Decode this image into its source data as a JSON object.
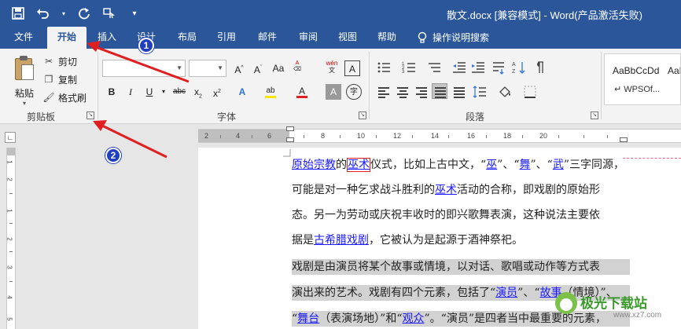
{
  "title_bar": {
    "title": "散文.docx [兼容模式] - Word(产品激活失败)",
    "qat": [
      {
        "icon": "save-icon",
        "glyph": "💾"
      },
      {
        "icon": "undo-icon",
        "glyph": "↶"
      },
      {
        "icon": "redo-icon",
        "glyph": "↻"
      },
      {
        "icon": "format-painter-qat-icon",
        "glyph": "⌐"
      },
      {
        "icon": "customize-qat-icon",
        "glyph": "▾"
      }
    ]
  },
  "tabs": [
    "文件",
    "开始",
    "插入",
    "设计",
    "布局",
    "引用",
    "邮件",
    "审阅",
    "视图",
    "帮助",
    "操作说明搜索"
  ],
  "active_tab": "开始",
  "clipboard": {
    "paste": "粘贴",
    "cut": "剪切",
    "copy": "复制",
    "format_painter": "格式刷",
    "group_label": "剪贴板"
  },
  "font": {
    "group_label": "字体",
    "name_value": "",
    "size_value": "",
    "buttons_row1": [
      "A^",
      "Aˇ",
      "Aa",
      "wén",
      "A"
    ],
    "buttons_row2": [
      "B",
      "I",
      "U",
      "abc",
      "x₂",
      "x²",
      "A",
      "ab",
      "A",
      "A",
      "A"
    ]
  },
  "paragraph": {
    "group_label": "段落"
  },
  "styles": {
    "sample": "AaBbCcDd",
    "name": "↵ WPSOf...",
    "sample2": "AaBl"
  },
  "ruler": {
    "h_numbers": [
      "2",
      "4",
      "6",
      "8",
      "10",
      "12",
      "14",
      "16",
      "18",
      "20"
    ],
    "v_numbers": [
      "1",
      "2",
      "1",
      "2",
      "3",
      "4",
      "5",
      "6"
    ]
  },
  "document": {
    "lines": [
      [
        {
          "t": "原始宗教",
          "c": "lk"
        },
        {
          "t": "的",
          "c": ""
        },
        {
          "t": "巫术",
          "c": "lk-sel"
        },
        {
          "t": "仪式，比如上古中文，“",
          "c": ""
        },
        {
          "t": "巫",
          "c": "lk"
        },
        {
          "t": "”、“",
          "c": ""
        },
        {
          "t": "舞",
          "c": "lk"
        },
        {
          "t": "”、“",
          "c": ""
        },
        {
          "t": "武",
          "c": "lk"
        },
        {
          "t": "”三字同源，",
          "c": ""
        }
      ],
      [
        {
          "t": "可能是对一种乞求战斗胜利的",
          "c": ""
        },
        {
          "t": "巫术",
          "c": "lk"
        },
        {
          "t": "活动的合称，即戏剧的原始形",
          "c": ""
        }
      ],
      [
        {
          "t": "态。另一为劳动或庆祝丰收时的即兴歌舞表演，这种说法主要依",
          "c": ""
        }
      ],
      [
        {
          "t": "据是",
          "c": ""
        },
        {
          "t": "古希腊戏剧",
          "c": "lk"
        },
        {
          "t": "，它被认为是起源于酒神祭祀。",
          "c": ""
        }
      ],
      [
        {
          "t": "戏剧是由演员将某个故事或情境，以对话、歌唱或动作等方式表",
          "c": ""
        }
      ],
      [
        {
          "t": "演出来的艺术。戏剧有四个元素，包括了“",
          "c": ""
        },
        {
          "t": "演员",
          "c": "lk"
        },
        {
          "t": "”、“",
          "c": ""
        },
        {
          "t": "故事",
          "c": "lk"
        },
        {
          "t": "（情境）”、",
          "c": ""
        }
      ],
      [
        {
          "t": "“",
          "c": ""
        },
        {
          "t": "舞台",
          "c": "lk"
        },
        {
          "t": "（表演场地）”和“",
          "c": ""
        },
        {
          "t": "观众",
          "c": "lk"
        },
        {
          "t": "”。“演员”是四者当中最重要的元素，",
          "c": ""
        }
      ]
    ]
  },
  "annotations": {
    "badge1": "1",
    "badge2": "2",
    "arrow_color": "#e02020"
  },
  "watermark": {
    "text": "极光下载站",
    "url": "www.xz7.com"
  }
}
